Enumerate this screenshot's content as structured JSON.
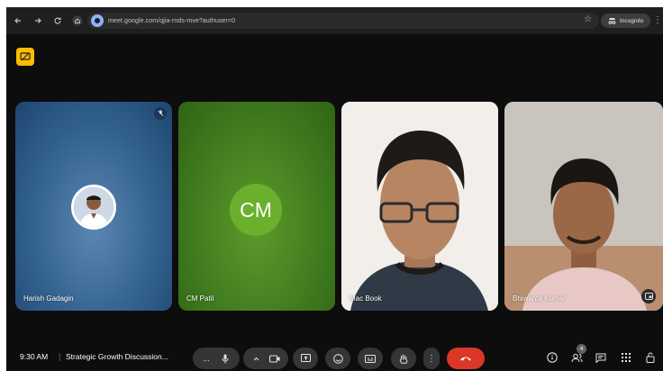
{
  "browser": {
    "url": "meet.google.com/qjia-rnds-mve?authuser=0",
    "incognito_label": "Incognito",
    "icons": [
      "back-icon",
      "forward-icon",
      "reload-icon",
      "home-icon",
      "site-info-icon",
      "bookmark-star-icon",
      "incognito-icon",
      "menu-icon"
    ]
  },
  "meet": {
    "participants": [
      {
        "name": "Harish Gadagin",
        "kind": "photo-avatar"
      },
      {
        "name": "CM Patil",
        "initials": "CM",
        "kind": "initials"
      },
      {
        "name": "Mac Book",
        "kind": "video"
      },
      {
        "name": "Bhiwanta Kumar",
        "kind": "video"
      }
    ],
    "toolbar": {
      "time": "9:30 AM",
      "separator": "|",
      "meeting_title": "Strategic Growth Discussion...",
      "people_count": "4",
      "more_label": "..."
    },
    "colors": {
      "cm_avatar": "#6bb02c",
      "end_call": "#dc3626",
      "active_speaker_outline": "#a8c7fa",
      "badge": "#fbbc04"
    }
  }
}
